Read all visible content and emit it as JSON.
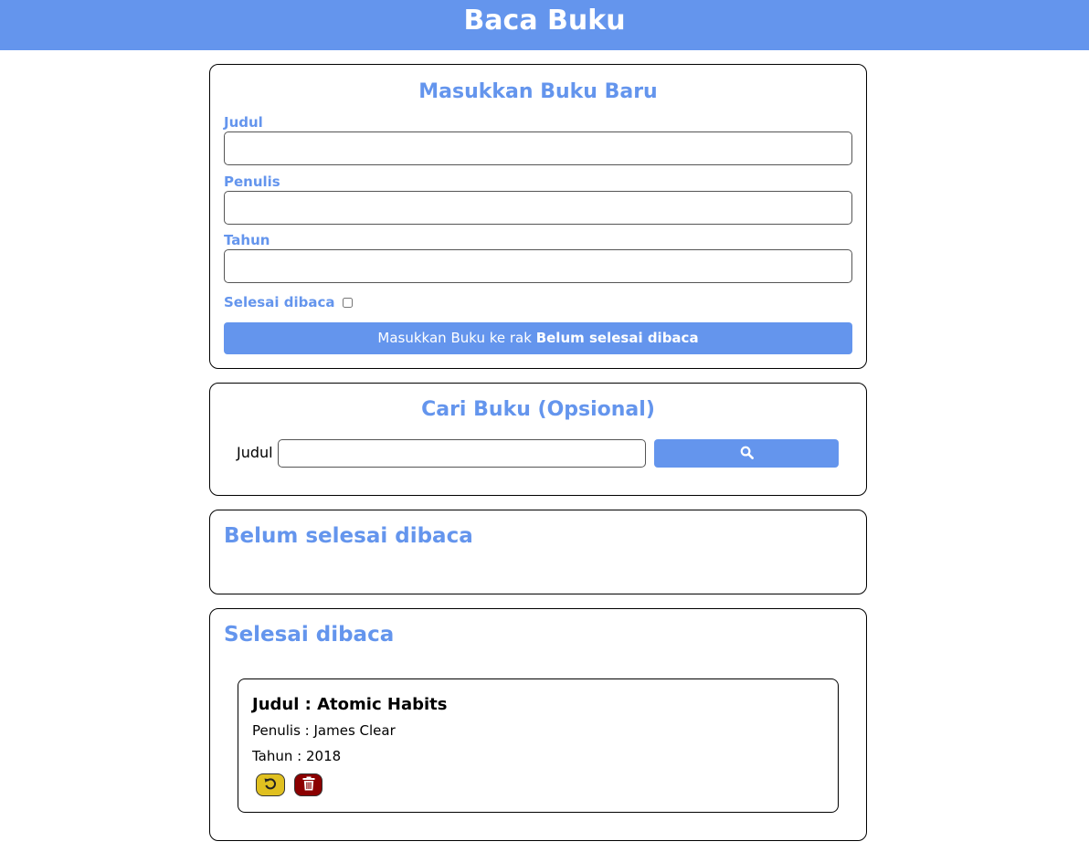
{
  "header": {
    "title": "Baca Buku"
  },
  "input_section": {
    "title": "Masukkan Buku Baru",
    "title_label": "Judul",
    "title_value": "",
    "author_label": "Penulis",
    "author_value": "",
    "year_label": "Tahun",
    "year_value": "",
    "complete_label": "Selesai dibaca",
    "complete_checked": false,
    "submit_prefix": "Masukkan Buku ke rak ",
    "submit_shelf": "Belum selesai dibaca"
  },
  "search_section": {
    "title": "Cari Buku (Opsional)",
    "label": "Judul",
    "value": "",
    "button_icon": "search-icon"
  },
  "incomplete_shelf": {
    "title": "Belum selesai dibaca",
    "books": []
  },
  "complete_shelf": {
    "title": "Selesai dibaca",
    "books": [
      {
        "title_line": "Judul : Atomic Habits",
        "author_line": "Penulis : James Clear",
        "year_line": "Tahun : 2018",
        "actions": [
          "undo-icon",
          "trash-icon"
        ]
      }
    ]
  },
  "colors": {
    "accent": "#6495ed",
    "undo": "#e0c020",
    "delete": "#8b0000"
  }
}
